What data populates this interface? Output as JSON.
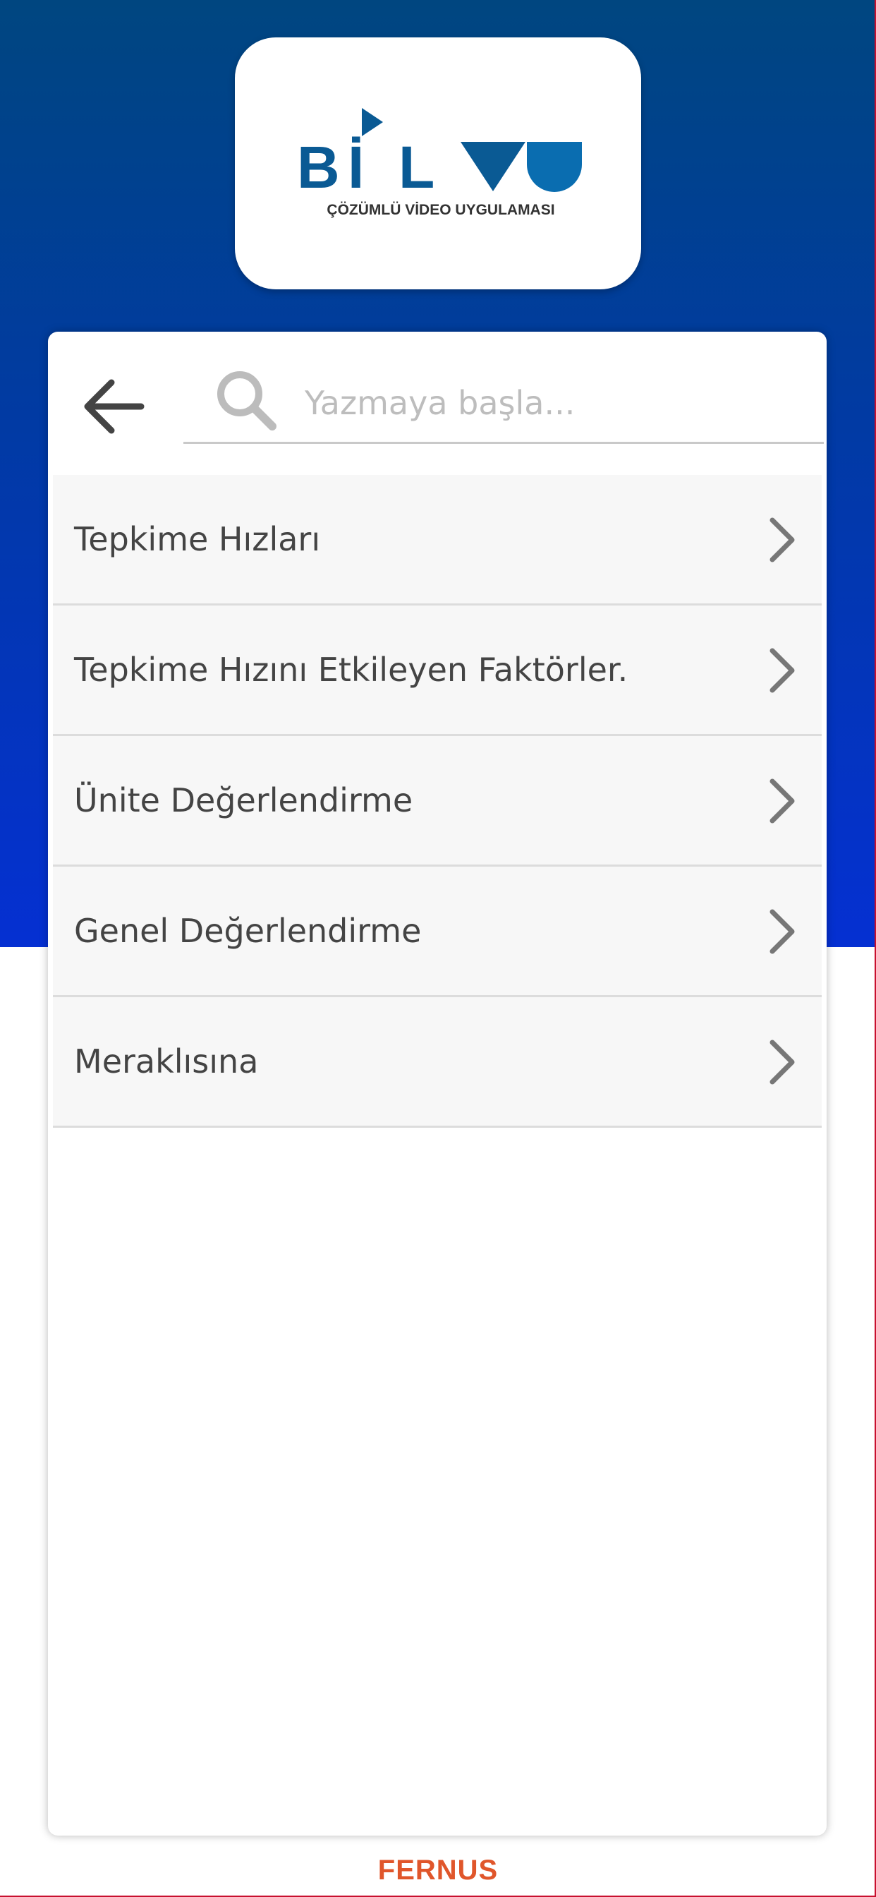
{
  "logo": {
    "wordmark_letters": [
      "B",
      "İ",
      "L"
    ],
    "tagline": "ÇÖZÜMLÜ VİDEO UYGULAMASI",
    "brand_color": "#0a5a94"
  },
  "search": {
    "placeholder": "Yazmaya başla...",
    "value": ""
  },
  "topics": [
    {
      "label": "Tepkime Hızları"
    },
    {
      "label": "Tepkime Hızını Etkileyen Faktörler."
    },
    {
      "label": "Ünite Değerlendirme"
    },
    {
      "label": "Genel Değerlendirme"
    },
    {
      "label": "Meraklısına"
    }
  ],
  "footer": {
    "brand": "FERNUS",
    "color": "#e0562b"
  },
  "colors": {
    "header_top": "#004680",
    "header_bottom": "#0530d2",
    "icon_gray": "#777777"
  },
  "icons": {
    "back": "arrow-left-icon",
    "search": "search-icon",
    "row": "chevron-right-icon"
  }
}
